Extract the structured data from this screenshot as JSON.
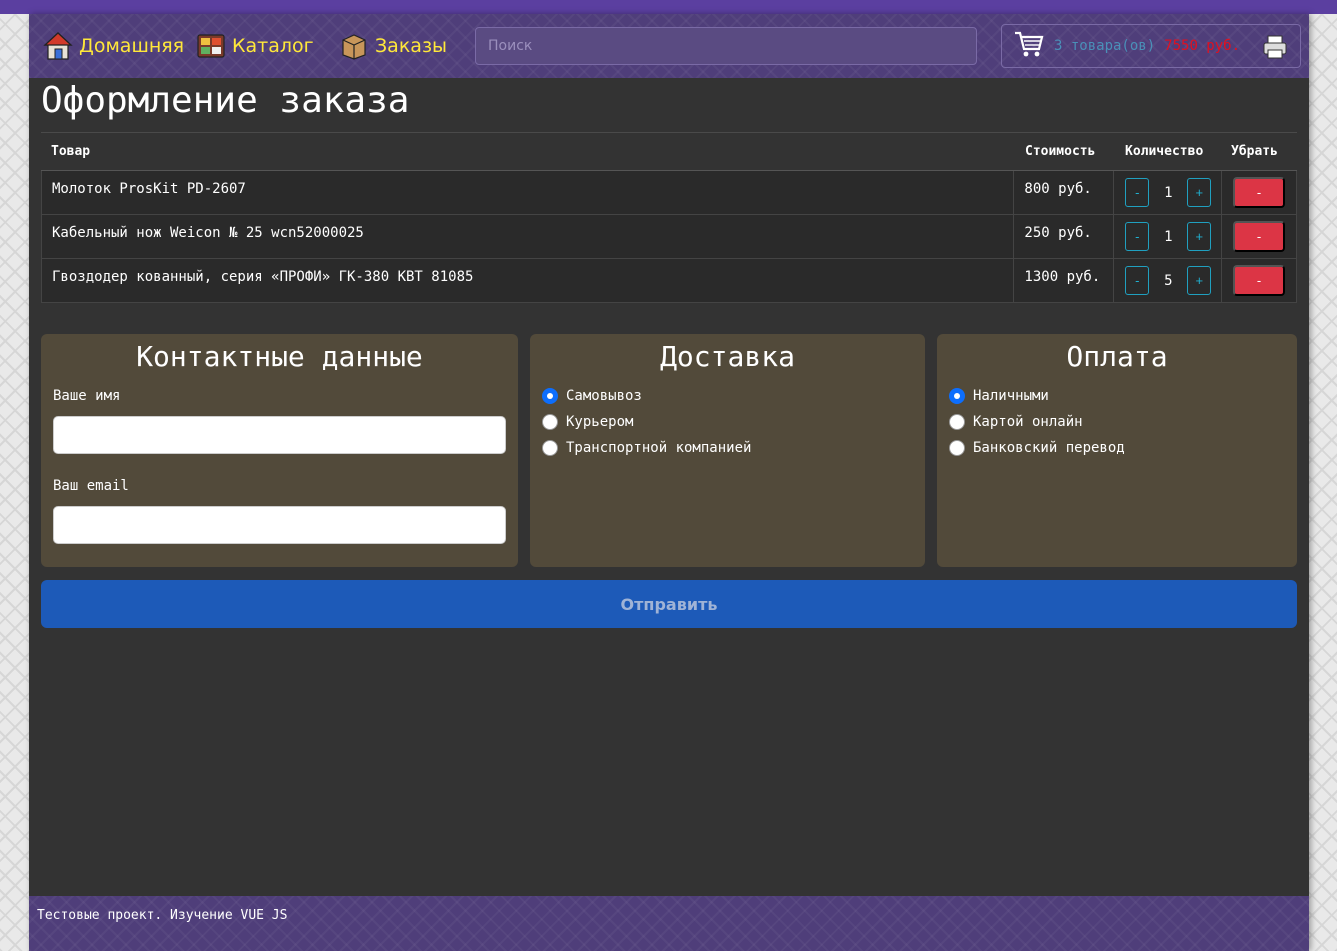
{
  "nav": {
    "home": "Домашняя",
    "catalog": "Каталог",
    "orders": "Заказы",
    "search_placeholder": "Поиск"
  },
  "cart": {
    "count_text": "3 товара(ов)",
    "total_text": "7550 руб."
  },
  "page_title": "Оформление заказа",
  "table": {
    "headers": {
      "product": "Товар",
      "price": "Стоимость",
      "qty": "Количество",
      "remove": "Убрать"
    },
    "rows": [
      {
        "name": "Молоток ProsKit PD-2607",
        "price": "800 руб.",
        "qty": "1"
      },
      {
        "name": "Кабельный нож Weicon № 25 wcn52000025",
        "price": "250 руб.",
        "qty": "1"
      },
      {
        "name": "Гвоздодер кованный, серия «ПРОФИ» ГК-380 KBT 81085",
        "price": "1300 руб.",
        "qty": "5"
      }
    ],
    "minus": "-",
    "plus": "+",
    "remove": "-"
  },
  "contacts": {
    "title": "Контактные данные",
    "name_label": "Ваше имя",
    "email_label": "Ваш email"
  },
  "delivery": {
    "title": "Доставка",
    "options": [
      "Самовывоз",
      "Курьером",
      "Транспортной компанией"
    ],
    "selected": 0
  },
  "payment": {
    "title": "Оплата",
    "options": [
      "Наличными",
      "Картой онлайн",
      "Банковский перевод"
    ],
    "selected": 0
  },
  "submit_label": "Отправить",
  "footer_text": "Тестовые проект. Изучение VUE JS",
  "colors": {
    "header": "#4f3e7a",
    "nav_text": "#ffe83a",
    "card_bg": "#524a3a",
    "submit_bg": "#1d5ab8",
    "remove_btn": "#dc3545"
  }
}
